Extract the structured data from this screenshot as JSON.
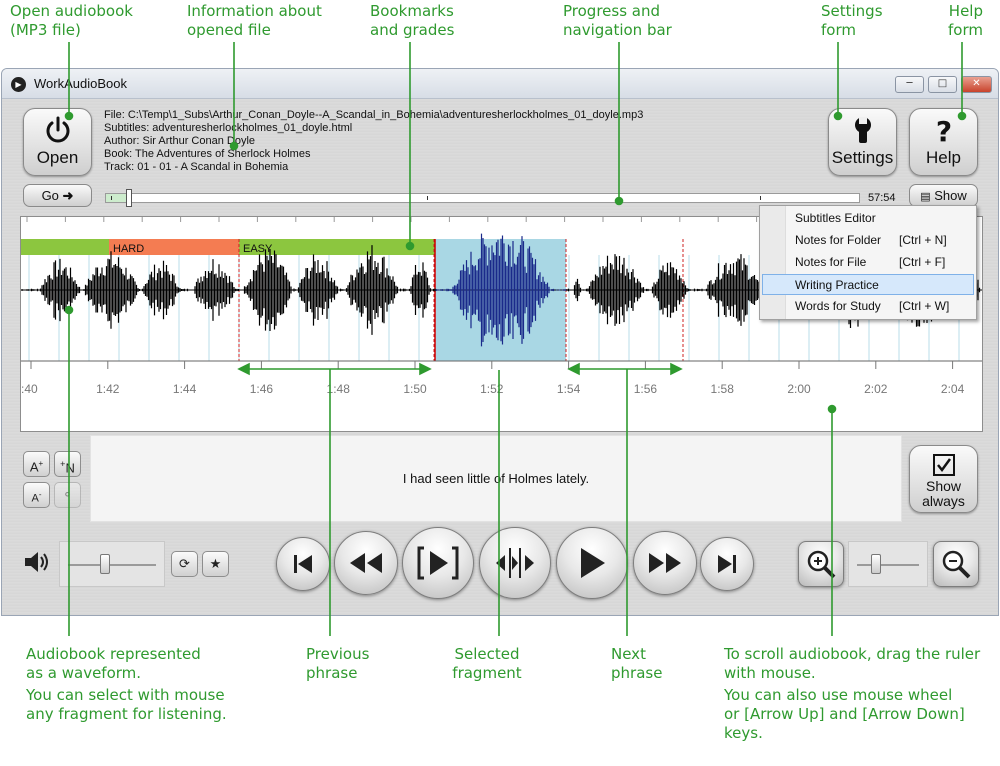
{
  "annotations": {
    "open": [
      "Open audiobook",
      "(MP3 file)"
    ],
    "info": [
      "Information about",
      "opened file"
    ],
    "bookmarks": [
      "Bookmarks",
      "and grades"
    ],
    "progress": [
      "Progress and",
      "navigation bar"
    ],
    "settings": [
      "Settings",
      "form"
    ],
    "help": [
      "Help",
      "form"
    ],
    "waveform": [
      "Audiobook represented",
      "as a waveform.",
      "You can select with mouse",
      "any fragment for listening."
    ],
    "previous": [
      "Previous",
      "phrase"
    ],
    "selected": [
      "Selected",
      "fragment"
    ],
    "next": [
      "Next",
      "phrase"
    ],
    "scroll": [
      "To scroll audiobook, drag the ruler",
      "with mouse.",
      "You can also use mouse wheel",
      "or [Arrow Up] and [Arrow Down]",
      "keys."
    ]
  },
  "window": {
    "title": "WorkAudioBook",
    "minimize_icon": "minimize-icon",
    "maximize_icon": "maximize-icon",
    "close_icon": "close-icon"
  },
  "toolbar": {
    "open_label": "Open",
    "settings_label": "Settings",
    "help_label": "Help",
    "go_label": "Go",
    "show_label": "Show"
  },
  "file_info": {
    "file": "File:  C:\\Temp\\1_Subs\\Arthur_Conan_Doyle--A_Scandal_in_Bohemia\\adventuresherlockholmes_01_doyle.mp3",
    "subtitles": "Subtitles:  adventuresherlockholmes_01_doyle.html",
    "author": "Author:  Sir Arthur Conan Doyle",
    "book": "Book:  The Adventures of Sherlock Holmes",
    "track": "Track:  01 - 01 - A Scandal in Bohemia"
  },
  "progress": {
    "total_time": "57:54",
    "position_fraction": 0.03
  },
  "grades": [
    {
      "label": "",
      "color": "#8cc63f"
    },
    {
      "label": "HARD",
      "color": "#f47c52"
    },
    {
      "label": "EASY",
      "color": "#8cc63f"
    }
  ],
  "ruler": {
    "ticks": [
      ":40",
      "1:42",
      "1:44",
      "1:46",
      "1:48",
      "1:50",
      "1:52",
      "1:54",
      "1:56",
      "1:58",
      "2:00",
      "2:02",
      "2:04"
    ]
  },
  "show_menu": {
    "items": [
      {
        "label": "Subtitles Editor",
        "shortcut": ""
      },
      {
        "label": "Notes for Folder",
        "shortcut": "[Ctrl + N]"
      },
      {
        "label": "Notes for File",
        "shortcut": "[Ctrl + F]"
      },
      {
        "label": "Writing Practice",
        "shortcut": ""
      },
      {
        "label": "Words for Study",
        "shortcut": "[Ctrl + W]"
      }
    ],
    "selected_index": 3
  },
  "subtitle": {
    "text": "I had seen little of Holmes lately."
  },
  "show_always": {
    "label_line1": "Show",
    "label_line2": "always"
  },
  "font_controls": {
    "increase": "A",
    "decrease": "A",
    "add_note": "N"
  },
  "volume": {
    "level": 0.4
  },
  "zoom": {
    "level": 0.25
  },
  "colors": {
    "accent_green": "#2f9a2f",
    "selection": "#a9d7e4",
    "waveform": "#000000",
    "waveform_selected": "#1a2a8a"
  }
}
